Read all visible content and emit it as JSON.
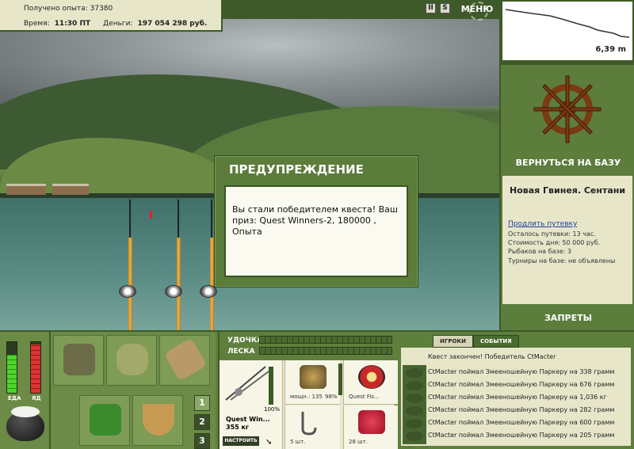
{
  "info": {
    "experience_label": "Получено опыта:",
    "experience_value": "37380",
    "time_label": "Время:",
    "time_value": "11:30 ПТ",
    "money_label": "Деньги:",
    "money_value": "197 054 298 руб."
  },
  "top_controls": {
    "pause_label": "II",
    "sound_label": "S",
    "menu_label": "МЕНЮ"
  },
  "depth": {
    "value": "6,39 m"
  },
  "right_panel": {
    "return_label": "ВЕРНУТЬСЯ НА БАЗУ",
    "location_title": "Новая Гвинея. Сентани",
    "prolong_link": "Продлить путевку",
    "remaining": "Осталось путевки: 13 час.",
    "day_cost": "Стоимость дня: 50 000 руб.",
    "anglers": "Рыбаков на базе: 3",
    "tournaments": "Турниры на базе: не объявлены",
    "bans_label": "ЗАПРЕТЫ"
  },
  "dialog": {
    "title": "ПРЕДУПРЕЖДЕНИЕ",
    "message": "Вы стали победителем квеста! Ваш приз: Quest Winners-2, 180000 , Опыта"
  },
  "status_bars": {
    "food_label": "ЕДА",
    "poison_label": "ЯД",
    "food_level": 0.75,
    "poison_level": 0.95
  },
  "inventory_tabs": [
    "1",
    "2",
    "3"
  ],
  "tackle": {
    "rod_label": "УДОЧКА",
    "line_label": "ЛЕСКА",
    "rod_name": "Quest Win...",
    "rod_weight": "355 кг",
    "rod_percent": "100%",
    "setup_label": "НАСТРОИТЬ",
    "reel_power": "мощн.: 135",
    "reel_percent": "98%",
    "line_name": "Quest Fis...",
    "hook_count": "5 шт.",
    "bait_count": "28 шт."
  },
  "log": {
    "tab_players": "ИГРОКИ",
    "tab_events": "СОБЫТИЯ",
    "header": "Квест закончен! Победитель CtMacter",
    "rows": [
      "CtMacter поймал Змееношейную Паркеру на 338 грамм",
      "CtMacter поймал Змееношейную Паркеру на 676 грамм",
      "CtMacter поймал Змееношейную Паркеру на 1,036 кг",
      "CtMacter поймал Змееношейную Паркеру на 282 грамм",
      "CtMacter поймал Змееношейную Паркеру на 600 грамм",
      "CtMacter поймал Змееношейную Паркеру на 205 грамм"
    ]
  }
}
